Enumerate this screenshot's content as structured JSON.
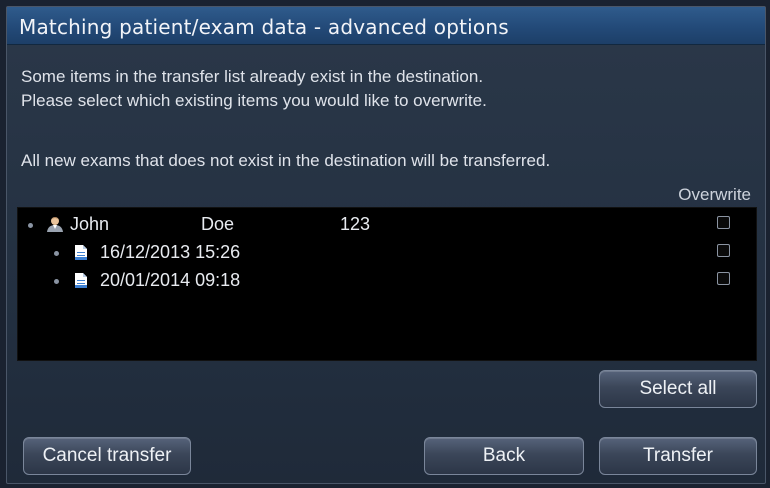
{
  "dialog": {
    "title": "Matching patient/exam data - advanced options",
    "message_line1": "Some items in the transfer list already exist in the destination.",
    "message_line2": "Please select which existing items you would like to overwrite.",
    "message_line3": "All new exams that does not exist in the destination will be transferred.",
    "overwrite_header": "Overwrite"
  },
  "list": {
    "patient": {
      "first_name": "John",
      "last_name": "Doe",
      "id": "123",
      "icon": "patient-icon",
      "overwrite": false
    },
    "exams": [
      {
        "datetime": "16/12/2013 15:26",
        "icon": "exam-document-icon",
        "overwrite": false
      },
      {
        "datetime": "20/01/2014 09:18",
        "icon": "exam-document-icon",
        "overwrite": false
      }
    ]
  },
  "buttons": {
    "select_all": "Select all",
    "cancel_transfer": "Cancel transfer",
    "back": "Back",
    "transfer": "Transfer"
  },
  "colors": {
    "title_bar": "#234a78",
    "dialog_bg": "#233041",
    "list_bg": "#000000",
    "text": "#dfe3ea"
  }
}
